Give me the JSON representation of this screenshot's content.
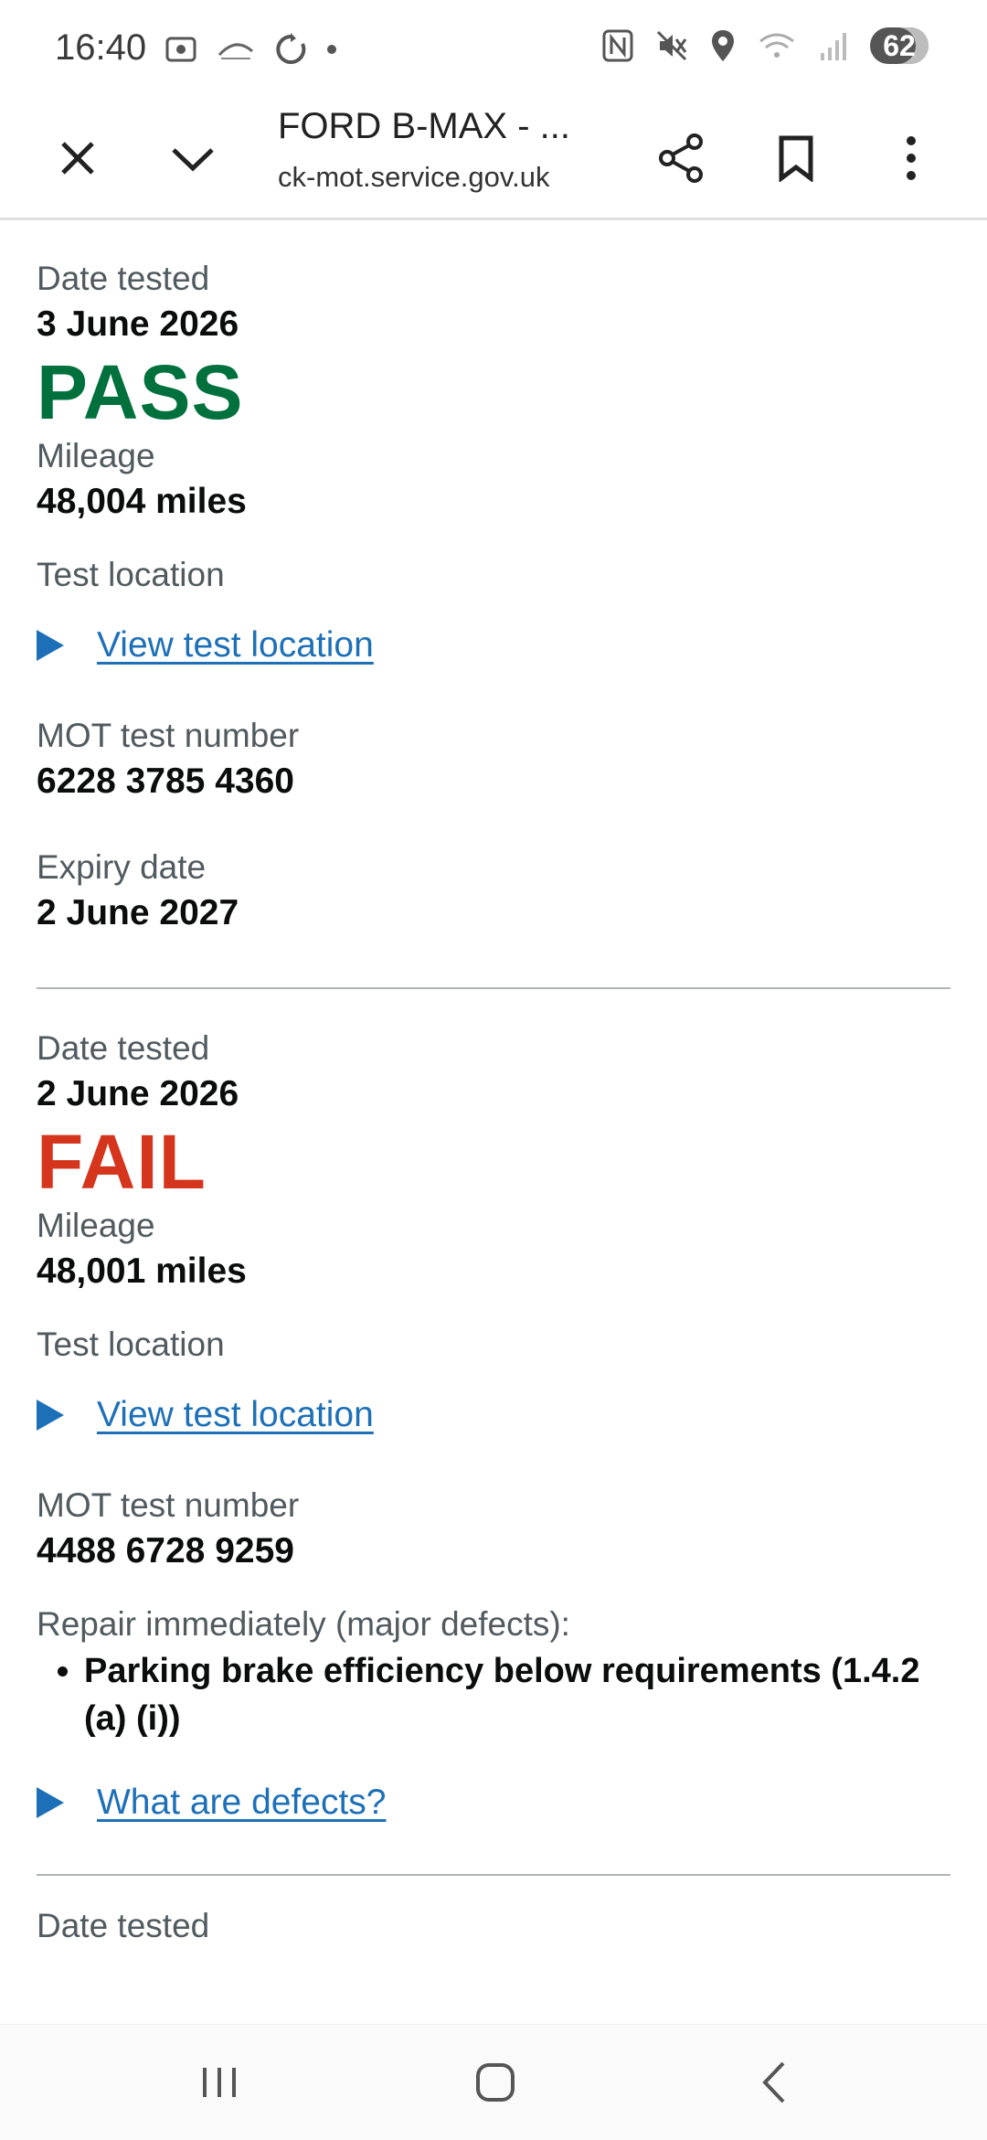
{
  "status_bar": {
    "time": "16:40",
    "battery": "62"
  },
  "browser": {
    "title": "FORD B-MAX - ...",
    "url": "ck-mot.service.gov.uk"
  },
  "tests": [
    {
      "date_label": "Date tested",
      "date": "3 June 2026",
      "result": "PASS",
      "mileage_label": "Mileage",
      "mileage": "48,004 miles",
      "location_label": "Test location",
      "location_link": "View test location",
      "number_label": "MOT test number",
      "number": "6228 3785 4360",
      "expiry_label": "Expiry date",
      "expiry": "2 June 2027"
    },
    {
      "date_label": "Date tested",
      "date": "2 June 2026",
      "result": "FAIL",
      "mileage_label": "Mileage",
      "mileage": "48,001 miles",
      "location_label": "Test location",
      "location_link": "View test location",
      "number_label": "MOT test number",
      "number": "4488 6728 9259",
      "defects_label": "Repair immediately (major defects):",
      "defects": [
        "Parking brake efficiency below requirements (1.4.2 (a) (i))"
      ],
      "defects_link": "What are defects?"
    }
  ],
  "partial_next_label": "Date tested",
  "colors": {
    "pass": "#00703c",
    "fail": "#d4351c",
    "link": "#1d70b8"
  }
}
